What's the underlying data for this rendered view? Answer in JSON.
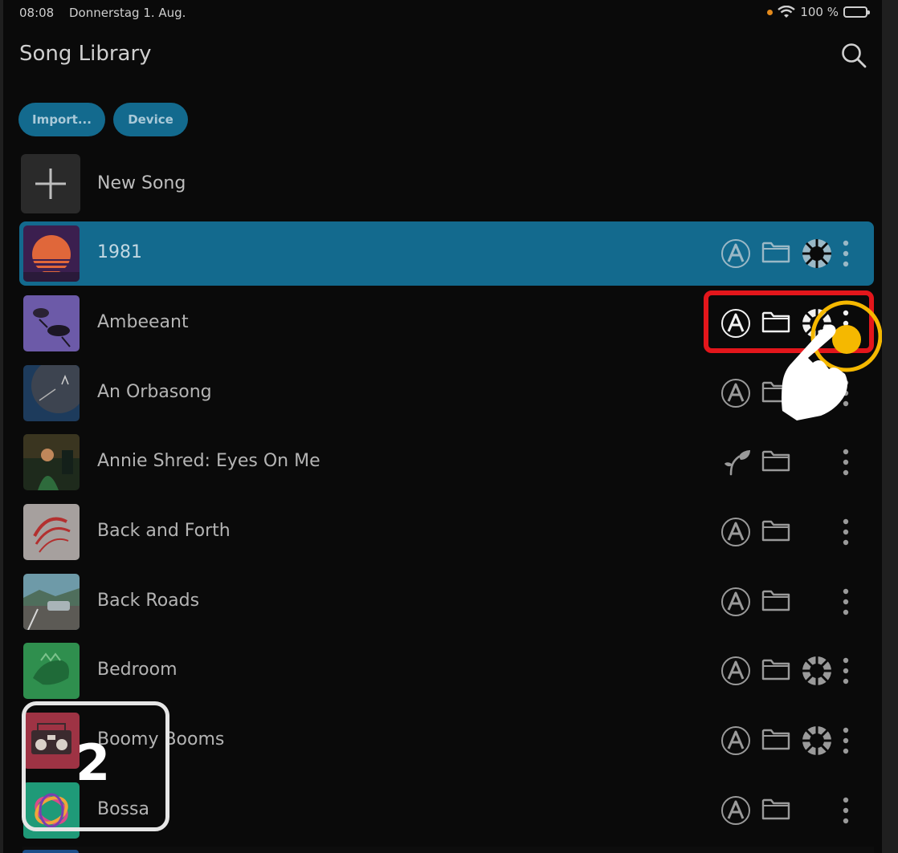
{
  "status_bar": {
    "time": "08:08",
    "date": "Donnerstag 1. Aug.",
    "battery": "100 %"
  },
  "header": {
    "title": "Song Library"
  },
  "toolbar": {
    "import_label": "Import...",
    "device_label": "Device"
  },
  "new_song": {
    "label": "New Song"
  },
  "songs": [
    {
      "title": "1981",
      "selected": true,
      "icons": [
        "a-icon",
        "folder-icon",
        "cloud-icon",
        "more-icon"
      ]
    },
    {
      "title": "Ambeeant",
      "icons": [
        "a-icon",
        "folder-icon",
        "cloud-icon",
        "more-icon"
      ]
    },
    {
      "title": "An Orbasong",
      "icons": [
        "a-icon",
        "folder-icon",
        "more-icon"
      ]
    },
    {
      "title": "Annie Shred: Eyes On Me",
      "icons": [
        "leaf-icon",
        "folder-icon",
        "more-icon"
      ]
    },
    {
      "title": "Back and Forth",
      "icons": [
        "a-icon",
        "folder-icon",
        "more-icon"
      ]
    },
    {
      "title": "Back Roads",
      "icons": [
        "a-icon",
        "folder-icon",
        "more-icon"
      ]
    },
    {
      "title": "Bedroom",
      "icons": [
        "a-icon",
        "folder-icon",
        "cloud-icon",
        "more-icon"
      ]
    },
    {
      "title": "Boomy Booms",
      "icons": [
        "a-icon",
        "folder-icon",
        "cloud-icon",
        "more-icon"
      ]
    },
    {
      "title": "Bossa",
      "icons": [
        "a-icon",
        "folder-icon",
        "more-icon"
      ]
    }
  ],
  "annotations": {
    "step_number": "2"
  },
  "colors": {
    "accent": "#136a8e",
    "highlight_red": "#e3161b",
    "highlight_yellow": "#f5b800"
  }
}
